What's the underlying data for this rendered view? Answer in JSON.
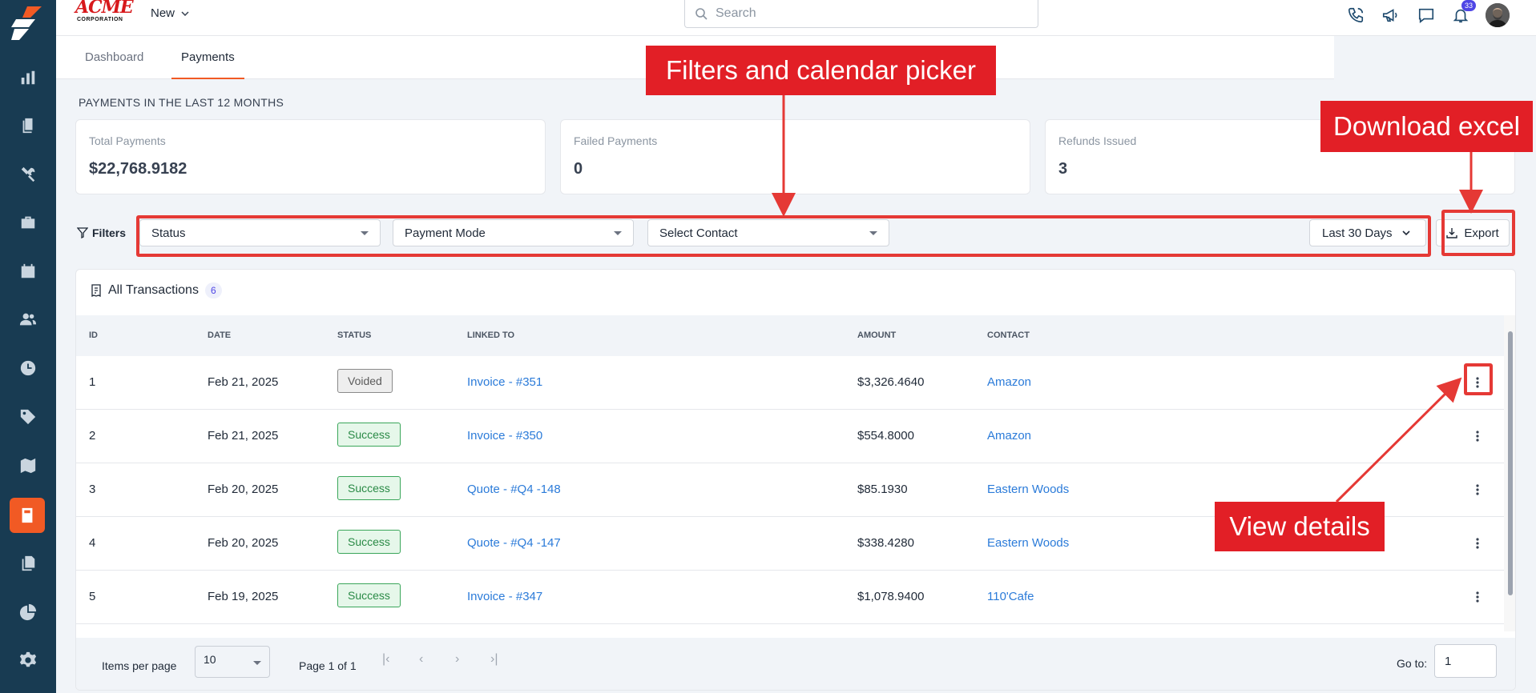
{
  "brand": {
    "name": "ACME",
    "sub": "CORPORATION"
  },
  "topbar": {
    "new_label": "New",
    "search_placeholder": "Search",
    "notifications_count": "33"
  },
  "tabs": [
    {
      "label": "Dashboard"
    },
    {
      "label": "Payments"
    }
  ],
  "section_title": "PAYMENTS IN THE LAST 12 MONTHS",
  "stats": [
    {
      "label": "Total Payments",
      "value": "$22,768.9182"
    },
    {
      "label": "Failed Payments",
      "value": "0"
    },
    {
      "label": "Refunds Issued",
      "value": "3"
    }
  ],
  "filters": {
    "label": "Filters",
    "status": "Status",
    "payment_mode": "Payment Mode",
    "contact": "Select Contact",
    "date_range": "Last 30 Days",
    "export": "Export"
  },
  "table": {
    "title": "All Transactions",
    "count": "6",
    "headers": [
      "ID",
      "DATE",
      "STATUS",
      "LINKED TO",
      "AMOUNT",
      "CONTACT"
    ],
    "rows": [
      {
        "id": "1",
        "date": "Feb 21, 2025",
        "status": "Voided",
        "linked": "Invoice - #351",
        "amount": "$3,326.4640",
        "contact": "Amazon"
      },
      {
        "id": "2",
        "date": "Feb 21, 2025",
        "status": "Success",
        "linked": "Invoice - #350",
        "amount": "$554.8000",
        "contact": "Amazon"
      },
      {
        "id": "3",
        "date": "Feb 20, 2025",
        "status": "Success",
        "linked": "Quote - #Q4 -148",
        "amount": "$85.1930",
        "contact": "Eastern Woods"
      },
      {
        "id": "4",
        "date": "Feb 20, 2025",
        "status": "Success",
        "linked": "Quote - #Q4 -147",
        "amount": "$338.4280",
        "contact": "Eastern Woods"
      },
      {
        "id": "5",
        "date": "Feb 19, 2025",
        "status": "Success",
        "linked": "Invoice - #347",
        "amount": "$1,078.9400",
        "contact": "110'Cafe"
      }
    ]
  },
  "pagination": {
    "items_per_page_label": "Items per page",
    "items_per_page": "10",
    "page_info": "Page 1 of 1",
    "goto_label": "Go to:",
    "goto_value": "1"
  },
  "annotations": {
    "filters": "Filters and calendar picker",
    "export": "Download excel",
    "details": "View details"
  },
  "colors": {
    "accent": "#f15a24",
    "sidebar": "#183b52",
    "annotation": "#e21f26",
    "link": "#2b7bd9"
  }
}
